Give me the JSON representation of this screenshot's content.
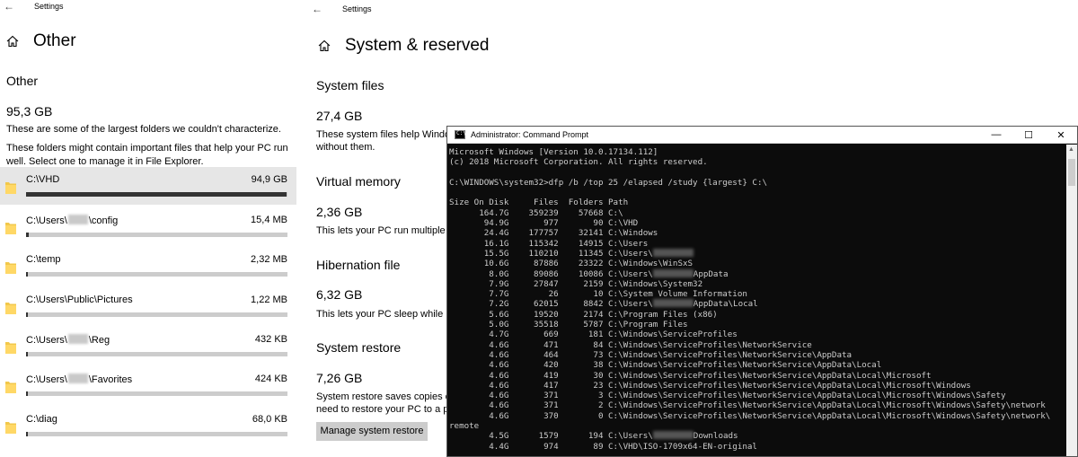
{
  "left": {
    "app_title": "Settings",
    "page_title": "Other",
    "section_heading": "Other",
    "total_size": "95,3 GB",
    "desc1": "These are some of the largest folders we couldn't characterize.",
    "desc2a": "These folders might contain important files that help your PC run",
    "desc2b": "well. Select one to manage it in File Explorer.",
    "folders": [
      {
        "prefix": "C:\\VHD",
        "suffix": "",
        "blurred": false,
        "size": "94,9 GB",
        "fill": 0.995
      },
      {
        "prefix": "C:\\Users\\",
        "suffix": "\\config",
        "blurred": true,
        "size": "15,4 MB",
        "fill": 0.01
      },
      {
        "prefix": "C:\\temp",
        "suffix": "",
        "blurred": false,
        "size": "2,32 MB",
        "fill": 0.008
      },
      {
        "prefix": "C:\\Users\\Public\\Pictures",
        "suffix": "",
        "blurred": false,
        "size": "1,22 MB",
        "fill": 0.008
      },
      {
        "prefix": "C:\\Users\\",
        "suffix": "\\Reg",
        "blurred": true,
        "size": "432 KB",
        "fill": 0.008
      },
      {
        "prefix": "C:\\Users\\",
        "suffix": "\\Favorites",
        "blurred": true,
        "size": "424 KB",
        "fill": 0.008
      },
      {
        "prefix": "C:\\diag",
        "suffix": "",
        "blurred": false,
        "size": "68,0 KB",
        "fill": 0.008
      }
    ]
  },
  "mid": {
    "app_title": "Settings",
    "page_title": "System & reserved",
    "system_files_heading": "System files",
    "system_files_size": "27,4 GB",
    "system_files_desc_a": "These system files help Windo",
    "system_files_desc_b": "without them.",
    "virtual_memory_heading": "Virtual memory",
    "virtual_memory_size": "2,36 GB",
    "virtual_memory_desc": "This lets your PC run multiple",
    "hibernation_heading": "Hibernation file",
    "hibernation_size": "6,32 GB",
    "hibernation_desc": "This lets your PC sleep while n",
    "restore_heading": "System restore",
    "restore_size": "7,26 GB",
    "restore_desc_a": "System restore saves copies o",
    "restore_desc_b": "need to restore your PC to a p",
    "manage_button": "Manage system restore"
  },
  "cmd": {
    "title": "Administrator: Command Prompt",
    "minimize": "—",
    "maximize": "☐",
    "close": "✕",
    "lines": [
      {
        "t": "Microsoft Windows [Version 10.0.17134.112]"
      },
      {
        "t": "(c) 2018 Microsoft Corporation. All rights reserved."
      },
      {
        "t": ""
      },
      {
        "t": "C:\\WINDOWS\\system32>dfp /b /top 25 /elapsed /study {largest} C:\\"
      },
      {
        "t": ""
      },
      {
        "t": "Size On Disk     Files  Folders Path"
      },
      {
        "t": "      164.7G    359239    57668 C:\\"
      },
      {
        "t": "       94.9G       977       90 C:\\VHD"
      },
      {
        "t": "       24.4G    177757    32141 C:\\Windows"
      },
      {
        "t": "       16.1G    115342    14915 C:\\Users"
      },
      {
        "t": "       15.5G    110210    11345 C:\\Users\\",
        "blur": true
      },
      {
        "t": "       10.6G     87886    23322 C:\\Windows\\WinSxS"
      },
      {
        "t": "        8.0G     89086    10086 C:\\Users\\",
        "blur": true,
        "after": "AppData"
      },
      {
        "t": "        7.9G     27847     2159 C:\\Windows\\System32"
      },
      {
        "t": "        7.7G        26       10 C:\\System Volume Information"
      },
      {
        "t": "        7.2G     62015     8842 C:\\Users\\",
        "blur": true,
        "after": "AppData\\Local"
      },
      {
        "t": "        5.6G     19520     2174 C:\\Program Files (x86)"
      },
      {
        "t": "        5.0G     35518     5787 C:\\Program Files"
      },
      {
        "t": "        4.7G       669      181 C:\\Windows\\ServiceProfiles"
      },
      {
        "t": "        4.6G       471       84 C:\\Windows\\ServiceProfiles\\NetworkService"
      },
      {
        "t": "        4.6G       464       73 C:\\Windows\\ServiceProfiles\\NetworkService\\AppData"
      },
      {
        "t": "        4.6G       420       38 C:\\Windows\\ServiceProfiles\\NetworkService\\AppData\\Local"
      },
      {
        "t": "        4.6G       419       30 C:\\Windows\\ServiceProfiles\\NetworkService\\AppData\\Local\\Microsoft"
      },
      {
        "t": "        4.6G       417       23 C:\\Windows\\ServiceProfiles\\NetworkService\\AppData\\Local\\Microsoft\\Windows"
      },
      {
        "t": "        4.6G       371        3 C:\\Windows\\ServiceProfiles\\NetworkService\\AppData\\Local\\Microsoft\\Windows\\Safety"
      },
      {
        "t": "        4.6G       371        2 C:\\Windows\\ServiceProfiles\\NetworkService\\AppData\\Local\\Microsoft\\Windows\\Safety\\network"
      },
      {
        "t": "        4.6G       370        0 C:\\Windows\\ServiceProfiles\\NetworkService\\AppData\\Local\\Microsoft\\Windows\\Safety\\network\\"
      },
      {
        "t": "remote"
      },
      {
        "t": "        4.5G      1579      194 C:\\Users\\",
        "blur": true,
        "after": "Downloads"
      },
      {
        "t": "        4.4G       974       89 C:\\VHD\\ISO-1709x64-EN-original"
      }
    ]
  }
}
